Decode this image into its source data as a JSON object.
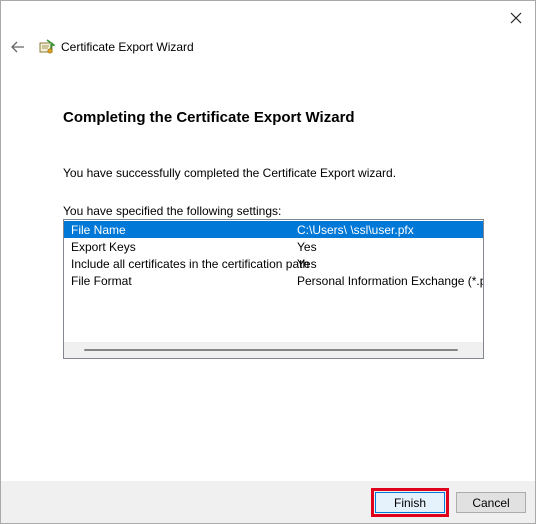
{
  "window": {
    "title": "Certificate Export Wizard"
  },
  "page": {
    "heading": "Completing the Certificate Export Wizard",
    "success_text": "You have successfully completed the Certificate Export wizard.",
    "settings_label": "You have specified the following settings:"
  },
  "settings": [
    {
      "name": "File Name",
      "value": "C:\\Users\\              \\ssl\\user.pfx",
      "selected": true
    },
    {
      "name": "Export Keys",
      "value": "Yes",
      "selected": false
    },
    {
      "name": "Include all certificates in the certification path",
      "value": "Yes",
      "selected": false
    },
    {
      "name": "File Format",
      "value": "Personal Information Exchange (*.pfx)",
      "selected": false
    }
  ],
  "buttons": {
    "finish": "Finish",
    "cancel": "Cancel"
  },
  "icons": {
    "close": "close-icon",
    "back": "back-arrow-icon",
    "wizard": "certificate-icon"
  },
  "colors": {
    "selection": "#0078d7",
    "highlight_box": "#e0001b"
  }
}
